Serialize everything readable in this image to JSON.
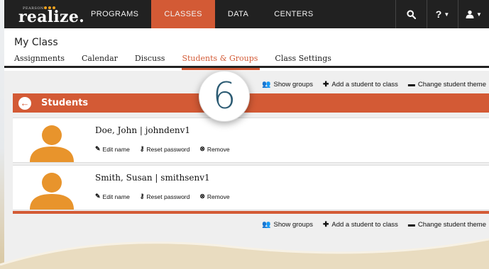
{
  "brand": {
    "word": "realize.",
    "publisher": "PEARSON"
  },
  "nav": {
    "items": [
      "PROGRAMS",
      "CLASSES",
      "DATA",
      "CENTERS"
    ],
    "active_index": 1,
    "search_icon": "search-icon",
    "help_label": "?",
    "user_icon": "user-icon"
  },
  "page": {
    "title": "My Class"
  },
  "tabs": {
    "items": [
      "Assignments",
      "Calendar",
      "Discuss",
      "Students & Groups",
      "Class Settings"
    ],
    "active_index": 3
  },
  "actions": {
    "show_groups": "Show groups",
    "add_student": "Add a student to class",
    "change_theme": "Change student theme"
  },
  "students_section": {
    "label": "Students"
  },
  "students": [
    {
      "name": "Doe, John | johndenv1",
      "edit": "Edit name",
      "reset": "Reset password",
      "remove": "Remove"
    },
    {
      "name": "Smith, Susan | smithsenv1",
      "edit": "Edit name",
      "reset": "Reset password",
      "remove": "Remove"
    }
  ],
  "step": {
    "number": "6"
  },
  "colors": {
    "accent": "#d35a35",
    "navbar": "#212121",
    "avatar": "#e8942c",
    "step_text": "#2c5b73"
  }
}
